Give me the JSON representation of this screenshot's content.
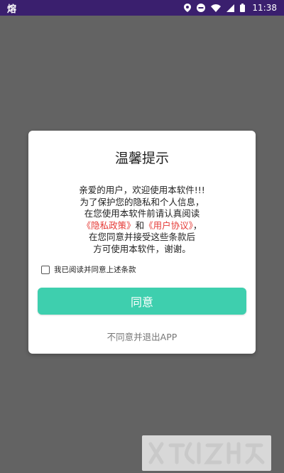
{
  "status_bar": {
    "app_glyph": "熔",
    "time": "11:38",
    "icons": [
      "location-icon",
      "do-not-disturb-icon",
      "wifi-icon",
      "signal-icon",
      "battery-icon"
    ]
  },
  "dialog": {
    "title": "温馨提示",
    "body": {
      "line1": "亲爱的用户，欢迎使用本软件!!!",
      "line2": "为了保护您的隐私和个人信息，",
      "line3": "在您使用本软件前请认真阅读",
      "privacy_policy": "《隐私政策》",
      "and": "和",
      "user_agreement": "《用户协议》",
      "comma": "，",
      "line5": "在您同意并接受这些条款后",
      "line6": "方可使用本软件，谢谢。"
    },
    "checkbox_label": "我已阅读并同意上述条款",
    "checkbox_checked": false,
    "agree_button": "同意",
    "disagree_link": "不同意并退出APP"
  },
  "colors": {
    "status_bar": "#3a1f6e",
    "background_dim": "#636363",
    "accent": "#3ecfae",
    "link": "#e53935"
  }
}
